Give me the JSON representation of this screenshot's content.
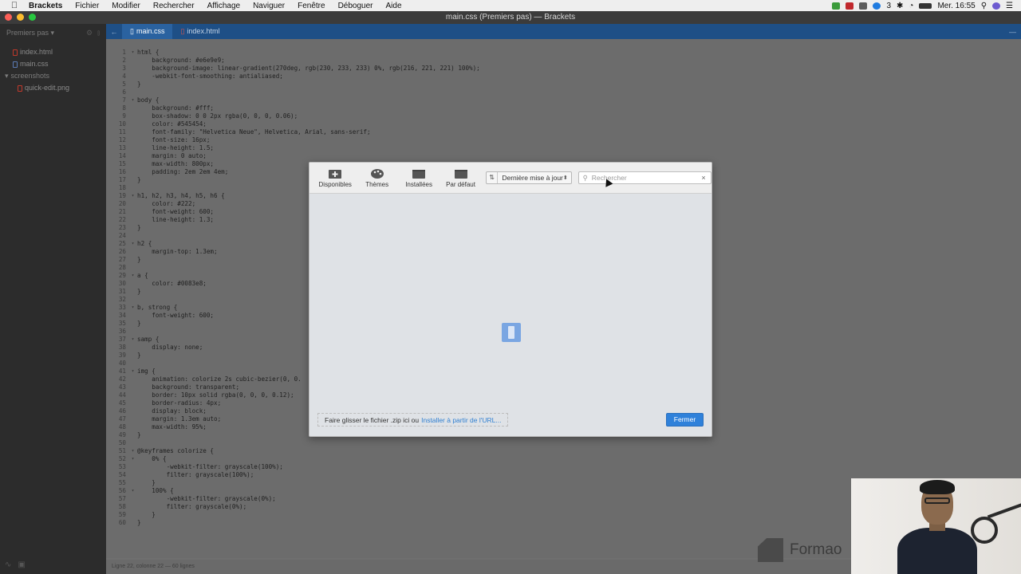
{
  "menubar": {
    "app_name": "Brackets",
    "items": [
      "Fichier",
      "Modifier",
      "Rechercher",
      "Affichage",
      "Naviguer",
      "Fenêtre",
      "Déboguer",
      "Aide"
    ],
    "status_badge": "3",
    "clock": "Mer. 16:55"
  },
  "window": {
    "title": "main.css (Premiers pas) — Brackets"
  },
  "sidebar": {
    "project": "Premiers pas",
    "files": [
      {
        "name": "index.html",
        "type": "html"
      },
      {
        "name": "main.css",
        "type": "css"
      }
    ],
    "folder": "screenshots",
    "folder_files": [
      {
        "name": "quick-edit.png",
        "type": "png"
      }
    ]
  },
  "tabs": [
    {
      "label": "main.css",
      "active": true
    },
    {
      "label": "index.html",
      "active": false
    }
  ],
  "editor": {
    "lines": [
      {
        "n": "1",
        "fold": "▾",
        "text": "html {"
      },
      {
        "n": "2",
        "fold": "",
        "text": "    background: #e6e9e9;"
      },
      {
        "n": "3",
        "fold": "",
        "text": "    background-image: linear-gradient(270deg, rgb(230, 233, 233) 0%, rgb(216, 221, 221) 100%);"
      },
      {
        "n": "4",
        "fold": "",
        "text": "    -webkit-font-smoothing: antialiased;"
      },
      {
        "n": "5",
        "fold": "",
        "text": "}"
      },
      {
        "n": "6",
        "fold": "",
        "text": ""
      },
      {
        "n": "7",
        "fold": "▾",
        "text": "body {"
      },
      {
        "n": "8",
        "fold": "",
        "text": "    background: #fff;"
      },
      {
        "n": "9",
        "fold": "",
        "text": "    box-shadow: 0 0 2px rgba(0, 0, 0, 0.06);"
      },
      {
        "n": "10",
        "fold": "",
        "text": "    color: #545454;"
      },
      {
        "n": "11",
        "fold": "",
        "text": "    font-family: \"Helvetica Neue\", Helvetica, Arial, sans-serif;"
      },
      {
        "n": "12",
        "fold": "",
        "text": "    font-size: 16px;"
      },
      {
        "n": "13",
        "fold": "",
        "text": "    line-height: 1.5;"
      },
      {
        "n": "14",
        "fold": "",
        "text": "    margin: 0 auto;"
      },
      {
        "n": "15",
        "fold": "",
        "text": "    max-width: 800px;"
      },
      {
        "n": "16",
        "fold": "",
        "text": "    padding: 2em 2em 4em;"
      },
      {
        "n": "17",
        "fold": "",
        "text": "}"
      },
      {
        "n": "18",
        "fold": "",
        "text": ""
      },
      {
        "n": "19",
        "fold": "▾",
        "text": "h1, h2, h3, h4, h5, h6 {"
      },
      {
        "n": "20",
        "fold": "",
        "text": "    color: #222;"
      },
      {
        "n": "21",
        "fold": "",
        "text": "    font-weight: 600;"
      },
      {
        "n": "22",
        "fold": "",
        "text": "    line-height: 1.3;"
      },
      {
        "n": "23",
        "fold": "",
        "text": "}"
      },
      {
        "n": "24",
        "fold": "",
        "text": ""
      },
      {
        "n": "25",
        "fold": "▾",
        "text": "h2 {"
      },
      {
        "n": "26",
        "fold": "",
        "text": "    margin-top: 1.3em;"
      },
      {
        "n": "27",
        "fold": "",
        "text": "}"
      },
      {
        "n": "28",
        "fold": "",
        "text": ""
      },
      {
        "n": "29",
        "fold": "▾",
        "text": "a {"
      },
      {
        "n": "30",
        "fold": "",
        "text": "    color: #0083e8;"
      },
      {
        "n": "31",
        "fold": "",
        "text": "}"
      },
      {
        "n": "32",
        "fold": "",
        "text": ""
      },
      {
        "n": "33",
        "fold": "▾",
        "text": "b, strong {"
      },
      {
        "n": "34",
        "fold": "",
        "text": "    font-weight: 600;"
      },
      {
        "n": "35",
        "fold": "",
        "text": "}"
      },
      {
        "n": "36",
        "fold": "",
        "text": ""
      },
      {
        "n": "37",
        "fold": "▾",
        "text": "samp {"
      },
      {
        "n": "38",
        "fold": "",
        "text": "    display: none;"
      },
      {
        "n": "39",
        "fold": "",
        "text": "}"
      },
      {
        "n": "40",
        "fold": "",
        "text": ""
      },
      {
        "n": "41",
        "fold": "▾",
        "text": "img {"
      },
      {
        "n": "42",
        "fold": "",
        "text": "    animation: colorize 2s cubic-bezier(0, 0."
      },
      {
        "n": "43",
        "fold": "",
        "text": "    background: transparent;"
      },
      {
        "n": "44",
        "fold": "",
        "text": "    border: 10px solid rgba(0, 0, 0, 0.12);"
      },
      {
        "n": "45",
        "fold": "",
        "text": "    border-radius: 4px;"
      },
      {
        "n": "46",
        "fold": "",
        "text": "    display: block;"
      },
      {
        "n": "47",
        "fold": "",
        "text": "    margin: 1.3em auto;"
      },
      {
        "n": "48",
        "fold": "",
        "text": "    max-width: 95%;"
      },
      {
        "n": "49",
        "fold": "",
        "text": "}"
      },
      {
        "n": "50",
        "fold": "",
        "text": ""
      },
      {
        "n": "51",
        "fold": "▾",
        "text": "@keyframes colorize {"
      },
      {
        "n": "52",
        "fold": "▾",
        "text": "    0% {"
      },
      {
        "n": "53",
        "fold": "",
        "text": "        -webkit-filter: grayscale(100%);"
      },
      {
        "n": "54",
        "fold": "",
        "text": "        filter: grayscale(100%);"
      },
      {
        "n": "55",
        "fold": "",
        "text": "    }"
      },
      {
        "n": "56",
        "fold": "▾",
        "text": "    100% {"
      },
      {
        "n": "57",
        "fold": "",
        "text": "        -webkit-filter: grayscale(0%);"
      },
      {
        "n": "58",
        "fold": "",
        "text": "        filter: grayscale(0%);"
      },
      {
        "n": "59",
        "fold": "",
        "text": "    }"
      },
      {
        "n": "60",
        "fold": "",
        "text": "}"
      }
    ]
  },
  "statusbar": {
    "text": "Ligne 22, colonne 22 — 60 lignes"
  },
  "extension_manager": {
    "tabs": [
      {
        "label": "Disponibles",
        "icon": "plus-box-icon"
      },
      {
        "label": "Thèmes",
        "icon": "palette-icon"
      },
      {
        "label": "Installées",
        "icon": "box-icon"
      },
      {
        "label": "Par défaut",
        "icon": "box-icon"
      }
    ],
    "sort_value": "Dernière mise à jour",
    "search_placeholder": "Rechercher",
    "drop_text": "Faire glisser le fichier .zip ici ou",
    "install_link": "Installer à partir de l'URL...",
    "close_button": "Fermer"
  },
  "watermark": {
    "brand": "Formao"
  },
  "colors": {
    "accent": "#2f81da",
    "tabbar": "#1e4f86",
    "spinner": "#7aa6e2"
  }
}
